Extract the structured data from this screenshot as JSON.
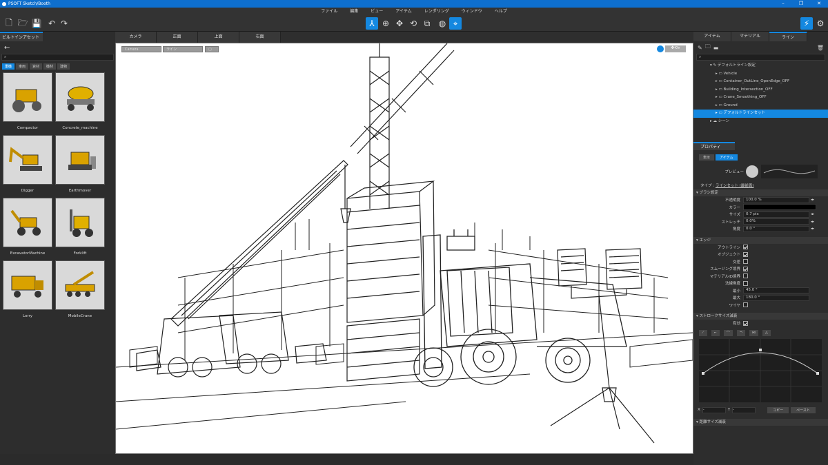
{
  "app": {
    "title": "PSOFT Sketch/Booth"
  },
  "menu": [
    "ファイル",
    "編集",
    "ビュー",
    "アイテム",
    "レンダリング",
    "ウィンドウ",
    "ヘルプ"
  ],
  "left_panel": {
    "tab": "ビルトインアセット",
    "categories": [
      "重機",
      "車両",
      "資材",
      "機材",
      "建物"
    ],
    "assets": [
      {
        "name": "Compactor",
        "icon": "compactor-icon"
      },
      {
        "name": "Concrete_machine",
        "icon": "concrete-mixer-icon"
      },
      {
        "name": "Digger",
        "icon": "digger-icon"
      },
      {
        "name": "Earthmover",
        "icon": "bulldozer-icon"
      },
      {
        "name": "ExcavatorMachine",
        "icon": "backhoe-icon"
      },
      {
        "name": "Forklift",
        "icon": "forklift-icon"
      },
      {
        "name": "Lorry",
        "icon": "dump-truck-icon"
      },
      {
        "name": "MobileCrane",
        "icon": "mobile-crane-icon"
      }
    ]
  },
  "view_tabs": [
    "カメラ",
    "正面",
    "上面",
    "右面"
  ],
  "viewport": {
    "camera_select": "Camera",
    "line_select": "ライン"
  },
  "right_panel": {
    "tabs": [
      "アイテム",
      "マテリアル",
      "ライン"
    ],
    "tree": [
      {
        "label": "デフォルトライン設定",
        "level": 1,
        "icon": "brush-icon"
      },
      {
        "label": "Vehicle",
        "level": 2
      },
      {
        "label": "Container_OutLine_OpenEdge_OFF",
        "level": 2
      },
      {
        "label": "Building_Intersection_OFF",
        "level": 2
      },
      {
        "label": "Crane_Smoothing_OFF",
        "level": 2
      },
      {
        "label": "Ground",
        "level": 2
      },
      {
        "label": "デフォルトラインセット",
        "level": 2,
        "selected": true
      },
      {
        "label": "シーン",
        "level": 1,
        "icon": "scene-icon"
      }
    ],
    "properties": {
      "tab": "プロパティ",
      "subtabs": [
        "表示",
        "アイテム"
      ],
      "preview_label": "プレビュー",
      "type_label": "タイプ",
      "type_value": "ラインセット (最前面)",
      "brush_section": "ブラシ設定",
      "brush": [
        {
          "label": "不透明度",
          "value": "100.0 %"
        },
        {
          "label": "カラー",
          "value": ""
        },
        {
          "label": "サイズ",
          "value": "0.7 pix"
        },
        {
          "label": "ストレッチ",
          "value": "0.0%"
        },
        {
          "label": "角度",
          "value": "0.0 °"
        }
      ],
      "edge_section": "エッジ",
      "edges": [
        {
          "label": "アウトライン",
          "checked": true
        },
        {
          "label": "オブジェクト",
          "checked": true
        },
        {
          "label": "交差",
          "checked": false
        },
        {
          "label": "スムージング境界",
          "checked": true
        },
        {
          "label": "マテリアルID境界",
          "checked": false
        },
        {
          "label": "法線角度",
          "checked": false
        }
      ],
      "min_label": "最小",
      "min_value": "45.0 °",
      "max_label": "最大",
      "max_value": "180.0 °",
      "wire_label": "ワイヤ",
      "stroke_section": "ストロークサイズ減衰",
      "enable_label": "有効",
      "x_label": "X",
      "y_label": "Y",
      "copy_label": "コピー",
      "paste_label": "ペースト",
      "distance_section": "距離サイズ減衰"
    }
  },
  "colors": {
    "accent": "#1488e0",
    "panel": "#2d2d2d",
    "title": "#0e6fce"
  }
}
